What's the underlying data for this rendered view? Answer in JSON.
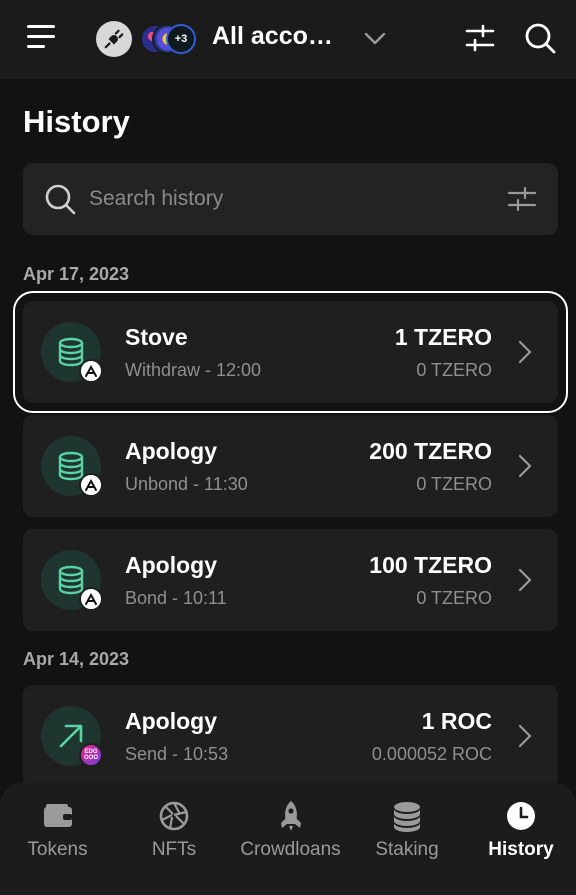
{
  "header": {
    "account_name": "All accou...",
    "avatar_more": "+3"
  },
  "page": {
    "title": "History"
  },
  "search": {
    "placeholder": "Search history"
  },
  "groups": [
    {
      "date": "Apr 17, 2023"
    },
    {
      "date": "Apr 14, 2023"
    }
  ],
  "transactions": [
    {
      "name": "Stove",
      "sub": "Withdraw - 12:00",
      "amount": "1 TZERO",
      "fiat": "0 TZERO",
      "icon": "database-icon",
      "badge": "aleph-zero"
    },
    {
      "name": "Apology",
      "sub": "Unbond - 11:30",
      "amount": "200 TZERO",
      "fiat": "0 TZERO",
      "icon": "database-icon",
      "badge": "aleph-zero"
    },
    {
      "name": "Apology",
      "sub": "Bond - 10:11",
      "amount": "100 TZERO",
      "fiat": "0 TZERO",
      "icon": "database-icon",
      "badge": "aleph-zero"
    },
    {
      "name": "Apology",
      "sub": "Send - 10:53",
      "amount": "1 ROC",
      "fiat": "0.000052 ROC",
      "icon": "arrow-up-right-icon",
      "badge": "edgeware"
    }
  ],
  "nav": [
    {
      "label": "Tokens",
      "icon": "wallet-icon"
    },
    {
      "label": "NFTs",
      "icon": "aperture-icon"
    },
    {
      "label": "Crowdloans",
      "icon": "rocket-icon"
    },
    {
      "label": "Staking",
      "icon": "coins-icon"
    },
    {
      "label": "History",
      "icon": "clock-icon",
      "active": true
    }
  ],
  "colors": {
    "background": "#121212",
    "card": "#1f1f1f",
    "accent_green": "#5ad3a4",
    "muted_text": "#8f8f8f"
  }
}
